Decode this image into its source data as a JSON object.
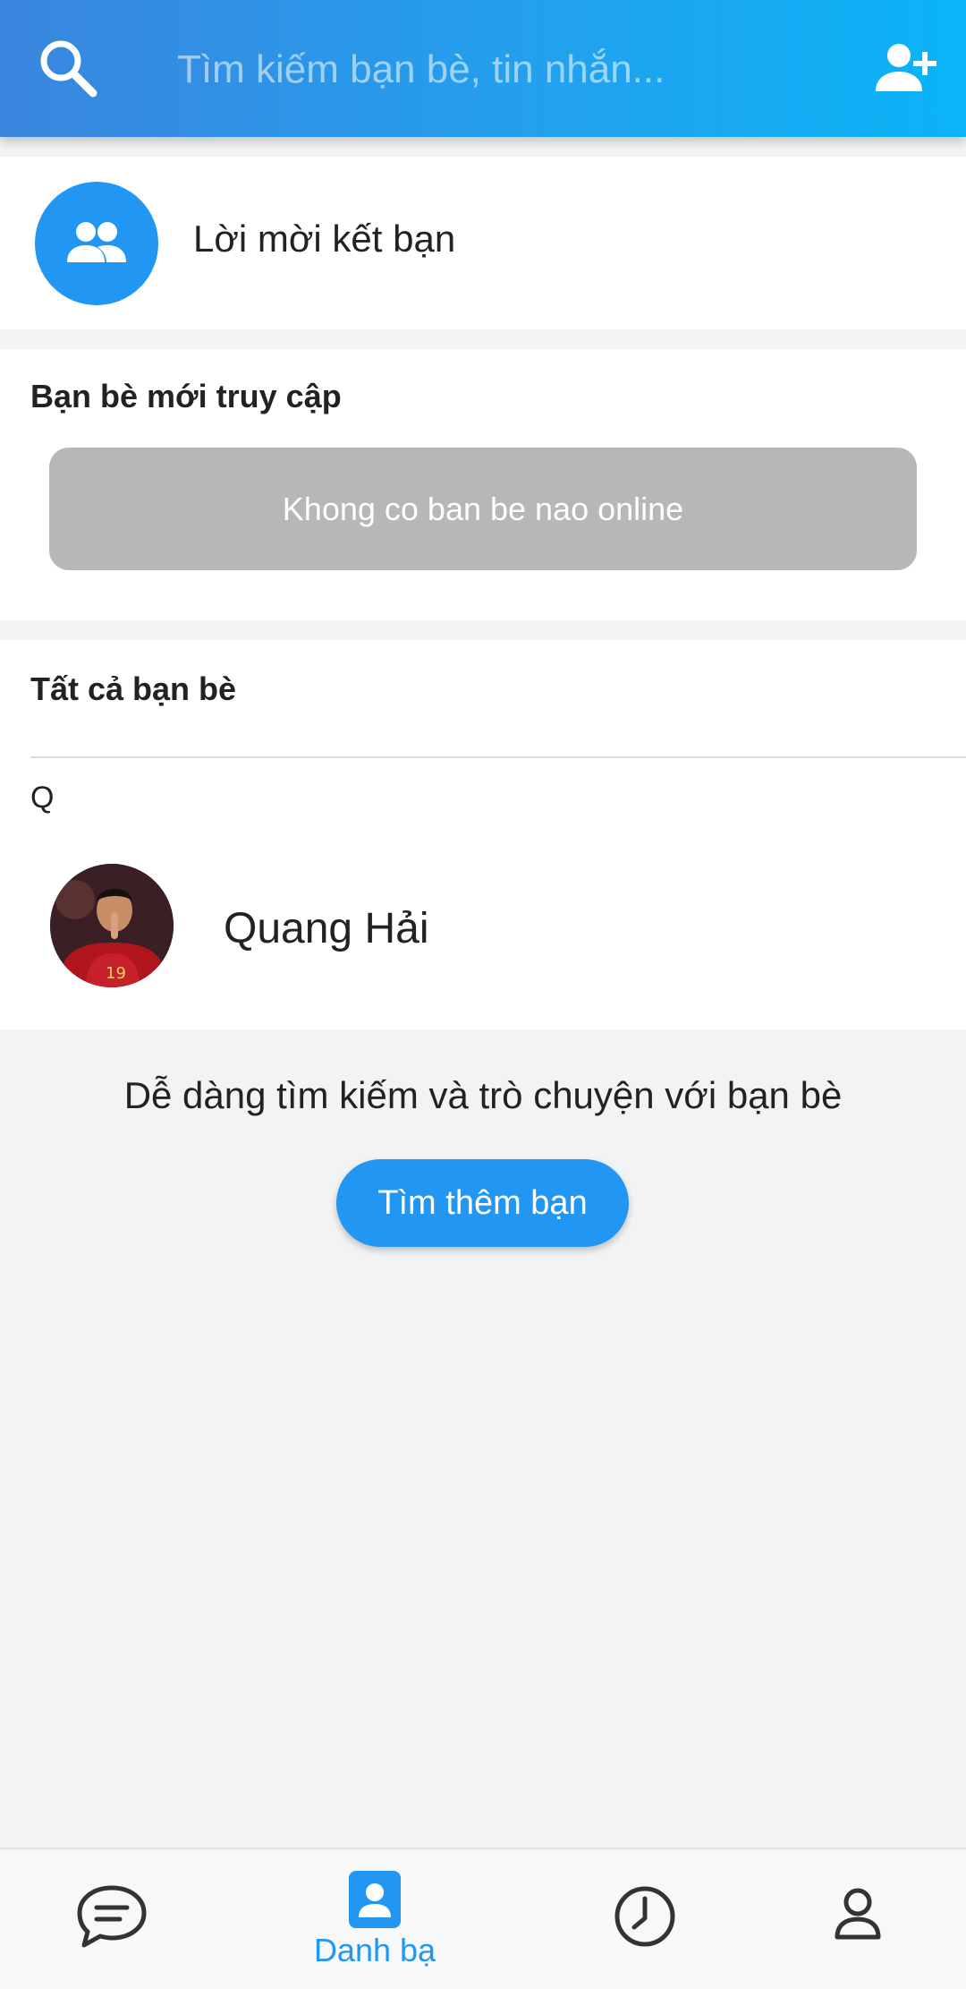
{
  "header": {
    "search_placeholder": "Tìm kiếm bạn bè, tin nhắn...",
    "icons": [
      "search-icon",
      "add-friend-icon"
    ],
    "gradient": [
      "#3a86de",
      "#0bb4f7"
    ]
  },
  "friend_requests": {
    "label": "Lời mời kết bạn",
    "icon": "people-icon",
    "icon_bg": "#2196f3"
  },
  "recent": {
    "title": "Bạn bè mới truy cập",
    "empty_message": "Khong co ban be nao online"
  },
  "all_friends": {
    "title": "Tất cả bạn bè",
    "groups": [
      {
        "letter": "Q",
        "friends": [
          {
            "name": "Quang Hải",
            "avatar": "avatar-photo"
          }
        ]
      }
    ]
  },
  "find_more": {
    "text": "Dễ dàng tìm kiếm và trò chuyện với bạn bè",
    "button_label": "Tìm thêm bạn"
  },
  "bottom_nav": {
    "active_color": "#2196f3",
    "items": [
      {
        "icon": "chat-icon",
        "label": ""
      },
      {
        "icon": "contacts-icon",
        "label": "Danh bạ",
        "active": true
      },
      {
        "icon": "clock-icon",
        "label": ""
      },
      {
        "icon": "user-icon",
        "label": ""
      }
    ]
  }
}
